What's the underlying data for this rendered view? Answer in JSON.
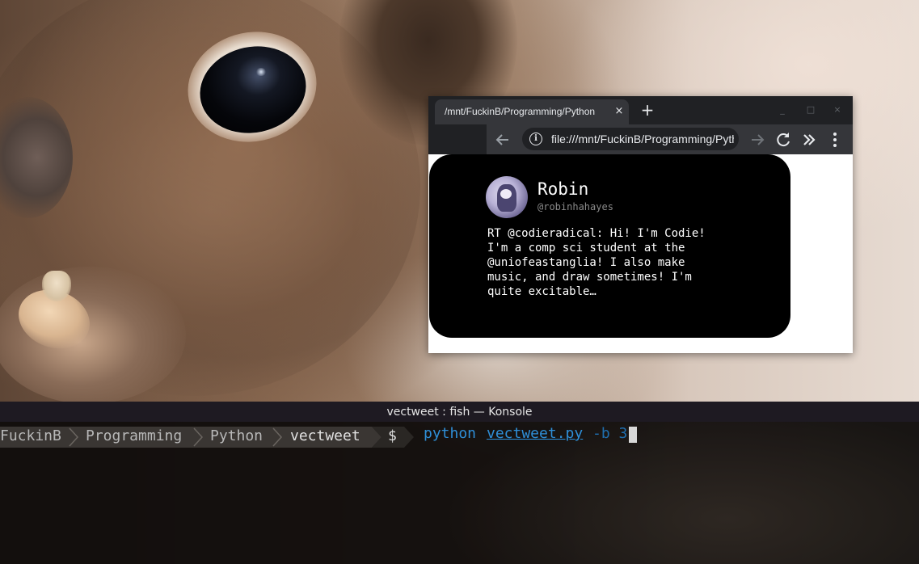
{
  "browser": {
    "tab_title": "/mnt/FuckinB/Programming/Python",
    "tab_close": "×",
    "new_tab": "+",
    "window_controls": [
      "_",
      "□",
      "×"
    ],
    "url": "file:///mnt/FuckinB/Programming/Python/vectweet/index.html",
    "icons": [
      "back-arrow-icon",
      "info-icon",
      "forward-arrow-icon",
      "reload-icon",
      "extensions-chevron-icon",
      "menu-kebab-icon"
    ]
  },
  "tweet": {
    "name": "Robin",
    "handle": "@robinhahayes",
    "lines": [
      "RT @codieradical: Hi! I'm Codie!",
      "I'm a comp sci student at the",
      "@uniofeastanglia! I also make",
      "music, and draw sometimes! I'm",
      "quite excitable…"
    ]
  },
  "konsole": {
    "title": "vectweet : fish — Konsole",
    "path_segments": [
      "FuckinB",
      "Programming",
      "Python",
      "vectweet"
    ],
    "prompt_symbol": "$",
    "command": "python",
    "script": "vectweet.py",
    "args": "-b 3"
  },
  "colors": {
    "tab_bg": "#35363a",
    "tabstrip_bg": "#202124",
    "card_bg": "#000000",
    "prompt_segment": "#3a3633",
    "command_blue": "#2f8fd8"
  }
}
